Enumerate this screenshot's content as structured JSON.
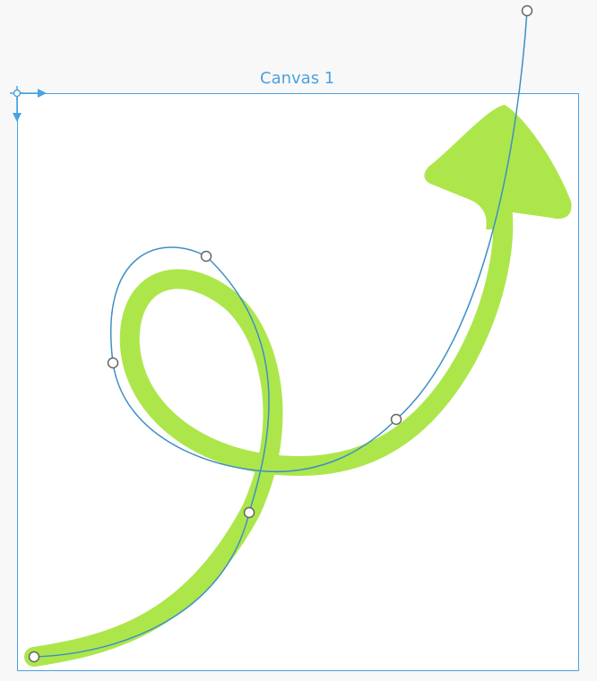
{
  "canvas": {
    "title": "Canvas 1"
  },
  "colors": {
    "accent": "#4aa3df",
    "stroke": "#ade64b",
    "path": "#3d8fc6",
    "handle_fill": "#ffffff",
    "handle_stroke": "#666666"
  },
  "icons": {
    "origin": "origin-crosshair-icon",
    "x_axis": "x-axis-arrow-icon",
    "y_axis": "y-axis-arrow-icon"
  }
}
